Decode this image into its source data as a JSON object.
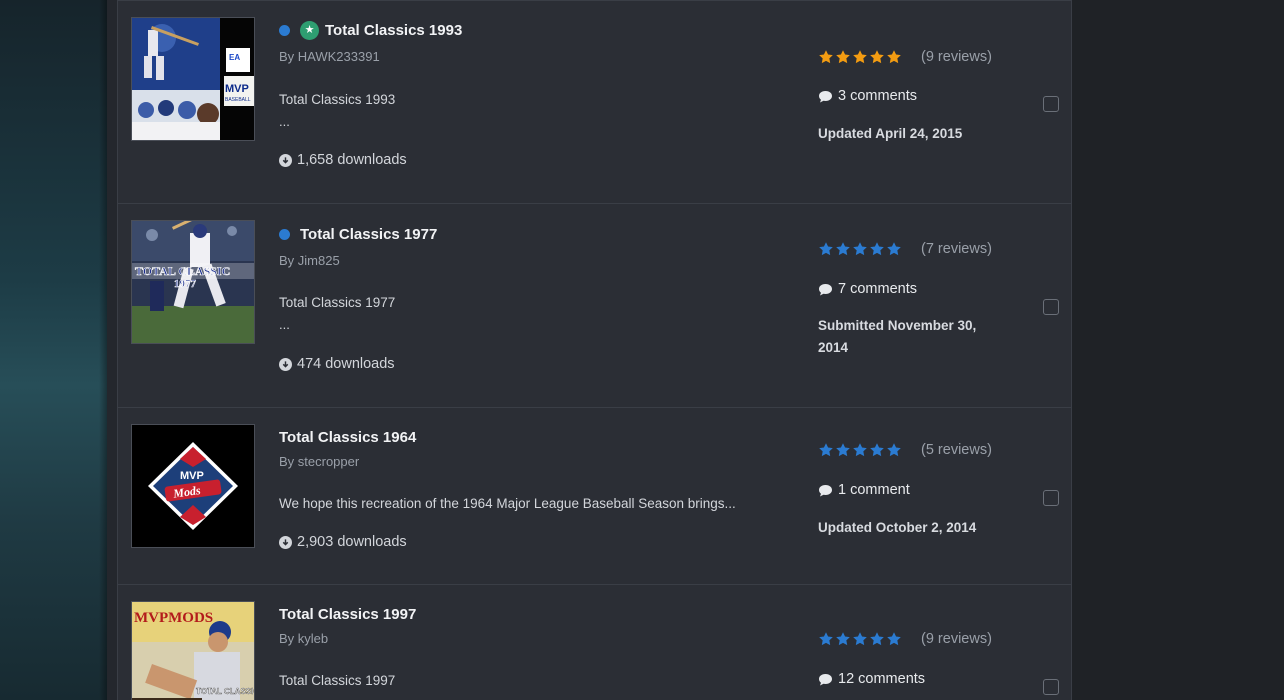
{
  "colors": {
    "accent_blue": "#2b7bd1",
    "star_orange": "#f39c12",
    "star_blue": "#2b7bd1",
    "featured_green": "#2e9e71"
  },
  "items": [
    {
      "title": "Total Classics 1993",
      "unread": true,
      "featured": true,
      "author": "By HAWK233391",
      "snippet": "Total Classics 1993",
      "snippet_more": "...",
      "downloads": "1,658 downloads",
      "rating": 5,
      "star_color": "orange",
      "reviews": "(9 reviews)",
      "comments": "3 comments",
      "date": "Updated April 24, 2015"
    },
    {
      "title": "Total Classics 1977",
      "unread": true,
      "featured": false,
      "author": "By Jim825",
      "snippet": "Total Classics 1977",
      "snippet_more": "...",
      "downloads": "474 downloads",
      "rating": 5,
      "star_color": "blue",
      "reviews": "(7 reviews)",
      "comments": "7 comments",
      "date": "Submitted November 30, 2014"
    },
    {
      "title": "Total Classics 1964",
      "unread": false,
      "featured": false,
      "author": "By stecropper",
      "snippet": "We hope this recreation of the 1964 Major League Baseball Season brings...",
      "snippet_more": "",
      "downloads": "2,903 downloads",
      "rating": 5,
      "star_color": "blue",
      "reviews": "(5 reviews)",
      "comments": "1 comment",
      "date": "Updated October 2, 2014"
    },
    {
      "title": "Total Classics 1997",
      "unread": false,
      "featured": false,
      "author": "By kyleb",
      "snippet": "Total Classics 1997",
      "snippet_more": "",
      "downloads": "",
      "rating": 5,
      "star_color": "blue",
      "reviews": "(9 reviews)",
      "comments": "12 comments",
      "date": ""
    }
  ],
  "thumbnails": {
    "t1993_logo_text": "MVP",
    "t1993_sub_text": "BASEBALL",
    "t1993_brand": "EA",
    "t1977_banner": "TOTAL CLASSIC",
    "t1977_year": "1977",
    "t1964_logo_top": "MVP",
    "t1964_logo_mid": "Mods",
    "t1997_top": "MVPMODS",
    "t1997_bottom": "TOTAL CLASSICS"
  }
}
